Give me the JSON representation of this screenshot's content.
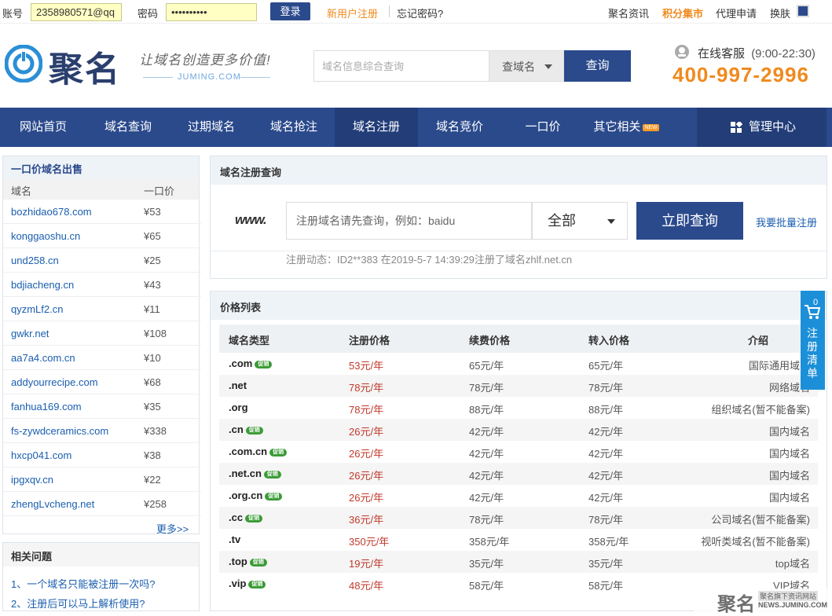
{
  "topbar": {
    "account_label": "账号",
    "account_value": "2358980571@qq",
    "password_label": "密码",
    "password_value": "••••••••••",
    "login_button": "登录",
    "register_link": "新用户注册",
    "forgot_link": "忘记密码?",
    "links": [
      "聚名资讯",
      "积分集市",
      "代理申请",
      "换肤"
    ]
  },
  "header": {
    "logo_text": "聚名",
    "slogan": "让域名创造更多价值!",
    "slogan_sub": "JUMING.COM",
    "search_placeholder": "域名信息综合查询",
    "search_type": "查域名",
    "search_button": "查询",
    "service_label": "在线客服",
    "service_hours": "(9:00-22:30)",
    "phone": "400-997-2996"
  },
  "nav": {
    "items": [
      "网站首页",
      "域名查询",
      "过期域名",
      "域名抢注",
      "域名注册",
      "域名竞价",
      "一口价",
      "其它相关"
    ],
    "new_badge": "NEW",
    "management": "管理中心"
  },
  "left_panel": {
    "title": "一口价域名出售",
    "col_domain": "域名",
    "col_price": "一口价",
    "rows": [
      {
        "domain": "bozhidao678.com",
        "price": "¥53"
      },
      {
        "domain": "konggaoshu.cn",
        "price": "¥65"
      },
      {
        "domain": "und258.cn",
        "price": "¥25"
      },
      {
        "domain": "bdjiacheng.cn",
        "price": "¥43"
      },
      {
        "domain": "qyzmLf2.cn",
        "price": "¥11"
      },
      {
        "domain": "gwkr.net",
        "price": "¥108"
      },
      {
        "domain": "aa7a4.com.cn",
        "price": "¥10"
      },
      {
        "domain": "addyourrecipe.com",
        "price": "¥68"
      },
      {
        "domain": "fanhua169.com",
        "price": "¥35"
      },
      {
        "domain": "fs-zywdceramics.com",
        "price": "¥338"
      },
      {
        "domain": "hxcp041.com",
        "price": "¥38"
      },
      {
        "domain": "ipgxqv.cn",
        "price": "¥22"
      },
      {
        "domain": "zhengLvcheng.net",
        "price": "¥258"
      }
    ],
    "more": "更多>>"
  },
  "faq": {
    "title": "相关问题",
    "items": [
      "1、一个域名只能被注册一次吗?",
      "2、注册后可以马上解析使用?"
    ]
  },
  "reg_query": {
    "title": "域名注册查询",
    "www": "www.",
    "input_placeholder": "注册域名请先查询，例如：baidu",
    "select_value": "全部",
    "query_button": "立即查询",
    "bulk_link": "我要批量注册",
    "dynamic": "注册动态：ID2**383 在2019-5-7 14:39:29注册了域名zhlf.net.cn"
  },
  "price_list": {
    "title": "价格列表",
    "headers": [
      "域名类型",
      "注册价格",
      "续费价格",
      "转入价格",
      "介绍"
    ],
    "promo_label": "促销",
    "rows": [
      {
        "type": ".com",
        "promo": true,
        "reg": "53元/年",
        "renew": "65元/年",
        "transfer": "65元/年",
        "desc": "国际通用域名"
      },
      {
        "type": ".net",
        "promo": false,
        "reg": "78元/年",
        "renew": "78元/年",
        "transfer": "78元/年",
        "desc": "网络域名"
      },
      {
        "type": ".org",
        "promo": false,
        "reg": "78元/年",
        "renew": "88元/年",
        "transfer": "88元/年",
        "desc": "组织域名(暂不能备案)"
      },
      {
        "type": ".cn",
        "promo": true,
        "reg": "26元/年",
        "renew": "42元/年",
        "transfer": "42元/年",
        "desc": "国内域名"
      },
      {
        "type": ".com.cn",
        "promo": true,
        "reg": "26元/年",
        "renew": "42元/年",
        "transfer": "42元/年",
        "desc": "国内域名"
      },
      {
        "type": ".net.cn",
        "promo": true,
        "reg": "26元/年",
        "renew": "42元/年",
        "transfer": "42元/年",
        "desc": "国内域名"
      },
      {
        "type": ".org.cn",
        "promo": true,
        "reg": "26元/年",
        "renew": "42元/年",
        "transfer": "42元/年",
        "desc": "国内域名"
      },
      {
        "type": ".cc",
        "promo": true,
        "reg": "36元/年",
        "renew": "78元/年",
        "transfer": "78元/年",
        "desc": "公司域名(暂不能备案)"
      },
      {
        "type": ".tv",
        "promo": false,
        "reg": "350元/年",
        "renew": "358元/年",
        "transfer": "358元/年",
        "desc": "视听类域名(暂不能备案)"
      },
      {
        "type": ".top",
        "promo": true,
        "reg": "19元/年",
        "renew": "35元/年",
        "transfer": "35元/年",
        "desc": "top域名"
      },
      {
        "type": ".vip",
        "promo": true,
        "reg": "48元/年",
        "renew": "58元/年",
        "transfer": "58元/年",
        "desc": "VIP域名"
      }
    ]
  },
  "cart": {
    "count": "0",
    "label": "注册清单"
  },
  "watermark": {
    "logo": "聚名",
    "line1": "聚名旗下资讯网站",
    "line2": "NEWS.JUMING.COM"
  },
  "colors": {
    "brand": "#2b4a8c",
    "phone": "#f08a1d",
    "price_red": "#c0392b",
    "link": "#1a5eb0",
    "promo_green": "#3a9b35",
    "cart_blue": "#1c8fd9"
  }
}
